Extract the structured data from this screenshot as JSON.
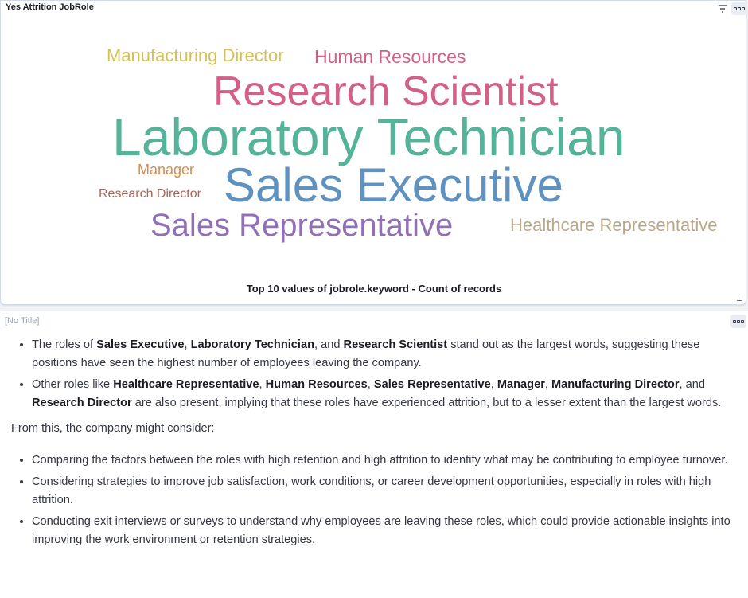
{
  "top_panel": {
    "title": "Yes Attrition JobRole",
    "words": [
      {
        "text": "Manufacturing Director",
        "color": "#d6bf57"
      },
      {
        "text": "Human Resources",
        "color": "#d36086"
      },
      {
        "text": "Research Scientist",
        "color": "#d36086"
      },
      {
        "text": "Laboratory Technician",
        "color": "#54b399"
      },
      {
        "text": "Manager",
        "color": "#da8b45"
      },
      {
        "text": "Sales Executive",
        "color": "#6092c0"
      },
      {
        "text": "Research Director",
        "color": "#aa6556"
      },
      {
        "text": "Sales Representative",
        "color": "#9170b8"
      },
      {
        "text": "Healthcare Representative",
        "color": "#b9a888"
      }
    ],
    "caption": "Top 10 values of jobrole.keyword - Count of records"
  },
  "bottom_panel": {
    "title": "[No Title]",
    "list1": {
      "item1": {
        "t1": "The roles of ",
        "b1": "Sales Executive",
        "t2": ", ",
        "b2": "Laboratory Technician",
        "t3": ", and ",
        "b3": "Research Scientist",
        "t4": " stand out as the largest words, suggesting these positions have seen the highest number of employees leaving the company."
      },
      "item2": {
        "t1": "Other roles like ",
        "b1": "Healthcare Representative",
        "t2": ", ",
        "b2": "Human Resources",
        "t3": ", ",
        "b3": "Sales Representative",
        "t4": ", ",
        "b4": "Manager",
        "t5": ", ",
        "b5": "Manufacturing Director",
        "t6": ", and ",
        "b6": "Research Director",
        "t7": " are also present, implying that these roles have experienced attrition, but to a lesser extent than the largest words."
      }
    },
    "paragraph": "From this, the company might consider:",
    "list2": [
      "Comparing the factors between the roles with high retention and high attrition to identify what may be contributing to employee turnover.",
      "Considering strategies to improve job satisfaction, work conditions, or career development opportunities, especially in roles with high attrition.",
      "Conducting exit interviews or surveys to understand why employees are leaving these roles, which could provide actionable insights into improving the work environment or retention strategies."
    ]
  },
  "icons": {
    "filter": "filter-icon",
    "options": "options-menu-icon"
  }
}
